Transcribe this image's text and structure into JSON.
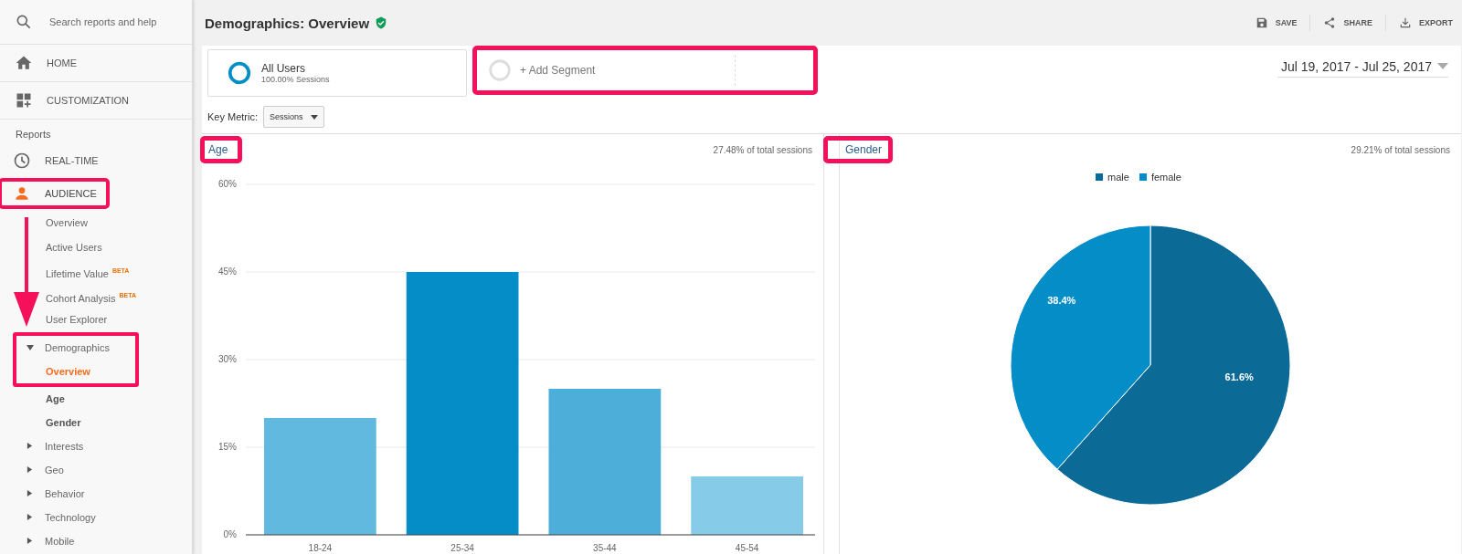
{
  "sidebar": {
    "search": {
      "placeholder": "Search reports and help"
    },
    "top_items": [
      {
        "label": "HOME",
        "kind": "home"
      },
      {
        "label": "CUSTOMIZATION",
        "kind": "customization"
      }
    ],
    "section_label": "Reports",
    "report_items": [
      {
        "label": "REAL-TIME",
        "kind": "clock",
        "selected": false,
        "highlighted": false
      },
      {
        "label": "AUDIENCE",
        "kind": "person",
        "selected": true,
        "highlighted": true,
        "children": [
          {
            "label": "Overview",
            "kind": "link",
            "selected": false
          },
          {
            "label": "Active Users",
            "kind": "link",
            "selected": false
          },
          {
            "label": "Lifetime Value",
            "badge": "BETA",
            "kind": "link",
            "selected": false
          },
          {
            "label": "Cohort Analysis",
            "badge": "BETA",
            "kind": "link",
            "selected": false
          },
          {
            "label": "User Explorer",
            "kind": "link",
            "selected": false
          },
          {
            "label": "Demographics",
            "kind": "group",
            "expanded": true,
            "highlighted": true,
            "children": [
              {
                "label": "Overview",
                "selected": true,
                "highlighted": true
              },
              {
                "label": "Age",
                "selected": false,
                "highlighted": false
              },
              {
                "label": "Gender",
                "selected": false,
                "highlighted": false
              }
            ]
          },
          {
            "label": "Interests",
            "kind": "group",
            "expanded": false
          },
          {
            "label": "Geo",
            "kind": "group",
            "expanded": false
          },
          {
            "label": "Behavior",
            "kind": "group",
            "expanded": false
          },
          {
            "label": "Technology",
            "kind": "group",
            "expanded": false
          },
          {
            "label": "Mobile",
            "kind": "group",
            "expanded": false
          }
        ]
      }
    ]
  },
  "callout_arrow": true,
  "header": {
    "title": "Demographics: Overview",
    "verified": true,
    "actions": [
      {
        "label": "SAVE",
        "kind": "save"
      },
      {
        "label": "SHARE",
        "kind": "share"
      },
      {
        "label": "EXPORT",
        "kind": "export"
      }
    ]
  },
  "segments": [
    {
      "name": "All Users",
      "detail": "100.00% Sessions",
      "kind": "segment"
    },
    {
      "name": "+ Add Segment",
      "kind": "add",
      "highlighted": true
    }
  ],
  "date_range": "Jul 19, 2017 - Jul 25, 2017",
  "key_metric": {
    "label": "Key Metric:",
    "value": "Sessions"
  },
  "panels": [
    {
      "title": "Age",
      "highlighted": true,
      "share": "27.48% of total sessions",
      "chart_data": {
        "type": "bar",
        "categories": [
          "18-24",
          "25-34",
          "35-44",
          "45-54"
        ],
        "grid": true,
        "series": [
          {
            "values": [
              20,
              45,
              25,
              10
            ],
            "colors": [
              "#62b9e0",
              "#058dc7",
              "#4daed9",
              "#86cbe8"
            ]
          }
        ],
        "ylim": [
          0,
          60
        ],
        "yticks": [
          {
            "value": 0,
            "label": "0%"
          },
          {
            "value": 15,
            "label": "15%"
          },
          {
            "value": 30,
            "label": "30%"
          },
          {
            "value": 45,
            "label": "45%"
          },
          {
            "value": 60,
            "label": "60%"
          }
        ]
      }
    },
    {
      "title": "Gender",
      "highlighted": true,
      "share": "29.21% of total sessions",
      "chart_data": {
        "type": "pie",
        "categories": [
          "male",
          "female"
        ],
        "series": [
          {
            "values": [
              61.6,
              38.4
            ],
            "colors": [
              "#0b6a96",
              "#058dc7"
            ]
          }
        ],
        "value_labels": [
          "61.6%",
          "38.4%"
        ]
      }
    }
  ]
}
